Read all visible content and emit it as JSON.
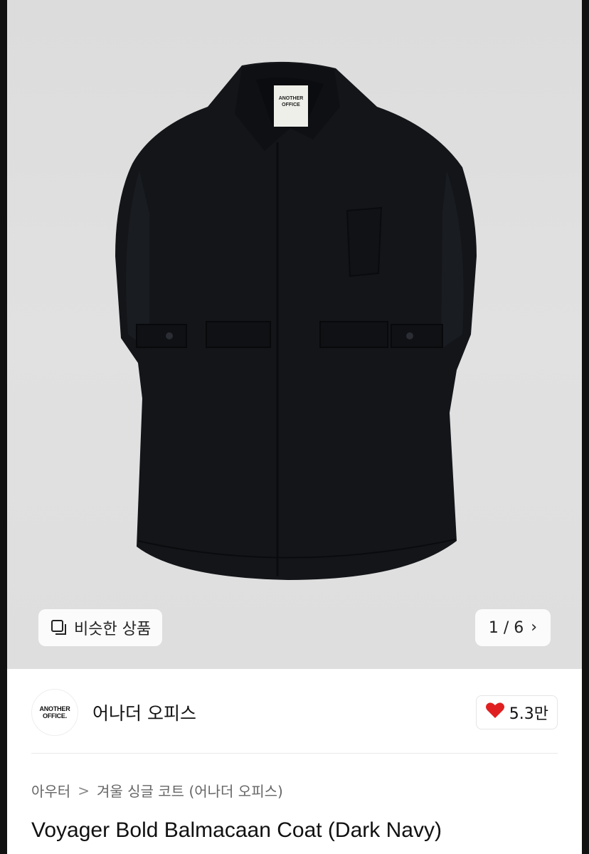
{
  "gallery": {
    "similar_label": "비슷한 상품",
    "similar_icon": "copy-icon",
    "pager_text": "1 / 6",
    "pager_icon": "chevron-right-icon",
    "coat_label": {
      "line1": "ANOTHER",
      "line2": "OFFICE"
    }
  },
  "seller": {
    "logo_line1": "ANOTHER",
    "logo_line2": "OFFICE.",
    "name": "어나더 오피스",
    "likes": "5.3만",
    "like_icon": "heart-icon",
    "like_color": "#e02020"
  },
  "breadcrumb": {
    "category": "아우터",
    "separator": ">",
    "subcategory": "겨울 싱글 코트 (어나더 오피스)"
  },
  "product": {
    "title": "Voyager Bold Balmacaan Coat (Dark Navy)"
  }
}
